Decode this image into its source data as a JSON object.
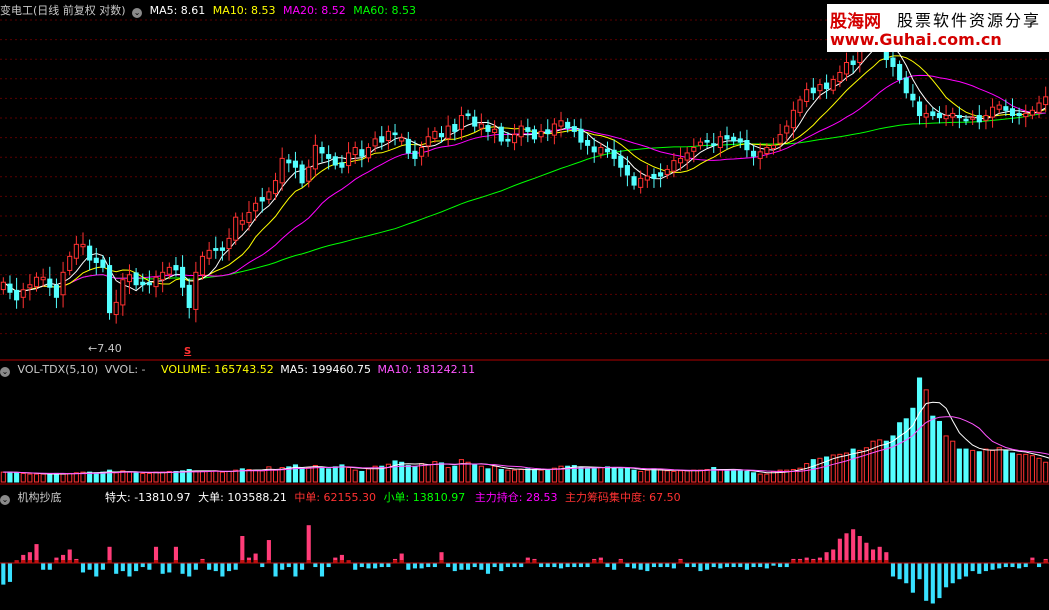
{
  "colors": {
    "up": "#ff3232",
    "down": "#54ffff",
    "ma5": "#ffffff",
    "ma10": "#ffff00",
    "ma20": "#ff00ff",
    "ma60": "#00ff00",
    "grid": "#5a0000",
    "sep": "#b00000",
    "vma5": "#ffffff",
    "vma10": "#ff55ff",
    "pos": "#ff3c78",
    "neg": "#38e0ff"
  },
  "price_header": {
    "title": "变电工(日线 前复权 对数)",
    "ma5_label": "MA5: 8.61",
    "ma10_label": "MA10: 8.53",
    "ma20_label": "MA20: 8.52",
    "ma60_label": "MA60: 8.53"
  },
  "watermark": {
    "line1": "股海网",
    "line2": "股票软件资源分享",
    "line3": "www.Guhai.com.cn"
  },
  "annotations": {
    "low_label": "←7.40",
    "s_marker": "S"
  },
  "volume_header": {
    "name": "VOL-TDX(5,10)",
    "vvol": "VVOL: -",
    "volume": "VOLUME: 165743.52",
    "ma5": "MA5: 199460.75",
    "ma10": "MA10: 181242.11"
  },
  "indicator_header": {
    "name": "机构抄底",
    "tedа": "",
    "teda": "特大: -13810.97",
    "dadan": "大单: 103588.21",
    "zhongdan": "中单: 62155.30",
    "xiaodan": "小单: 13810.97",
    "zhuli_chicang": "主力持仓: 28.53",
    "zhuli_jizhong": "主力筹码集中度: 67.50"
  },
  "chart_data": [
    {
      "type": "candlestick",
      "title": "变电工(日线 前复权 对数)",
      "y_estimated_range": [
        7.2,
        10.2
      ],
      "low_annotation": 7.4,
      "closes": [
        7.74,
        7.66,
        7.6,
        7.68,
        7.72,
        7.78,
        7.78,
        7.7,
        7.62,
        7.82,
        7.95,
        8.05,
        8.05,
        7.92,
        7.9,
        7.86,
        7.5,
        7.58,
        7.76,
        7.8,
        7.72,
        7.72,
        7.72,
        7.78,
        7.82,
        7.86,
        7.84,
        7.7,
        7.54,
        7.82,
        7.95,
        8.0,
        8.0,
        8.0,
        8.1,
        8.28,
        8.25,
        8.32,
        8.4,
        8.42,
        8.5,
        8.6,
        8.8,
        8.76,
        8.72,
        8.58,
        8.72,
        8.92,
        8.85,
        8.8,
        8.74,
        8.72,
        8.85,
        8.9,
        8.82,
        8.9,
        8.98,
        8.95,
        9.05,
        9.02,
        8.99,
        8.85,
        8.8,
        8.9,
        9.0,
        9.05,
        9.0,
        9.1,
        9.05,
        9.2,
        9.2,
        9.1,
        9.12,
        9.05,
        9.07,
        8.96,
        8.96,
        9.02,
        9.1,
        9.05,
        8.98,
        9.05,
        9.03,
        9.12,
        9.15,
        9.08,
        9.05,
        8.95,
        8.92,
        8.86,
        8.9,
        8.86,
        8.8,
        8.72,
        8.65,
        8.56,
        8.62,
        8.64,
        8.62,
        8.64,
        8.7,
        8.78,
        8.8,
        8.85,
        8.9,
        8.95,
        8.95,
        8.92,
        9.0,
        8.98,
        8.96,
        8.95,
        8.88,
        8.82,
        8.86,
        8.9,
        8.92,
        9.02,
        9.1,
        9.25,
        9.35,
        9.45,
        9.42,
        9.5,
        9.46,
        9.55,
        9.62,
        9.72,
        9.7,
        9.85,
        9.95,
        10.0,
        10.05,
        9.75,
        9.68,
        9.55,
        9.42,
        9.35,
        9.2,
        9.22,
        9.2,
        9.18,
        9.2,
        9.22,
        9.18,
        9.15,
        9.18,
        9.14,
        9.2,
        9.28,
        9.3,
        9.25,
        9.2,
        9.2,
        9.22,
        9.25,
        9.32,
        9.38
      ]
    },
    {
      "type": "bar",
      "title": "VOL-TDX(5,10)",
      "volume_latest": 165743.52,
      "ma5_latest": 199460.75,
      "ma10_latest": 181242.11,
      "values": [
        15,
        15,
        14,
        13,
        12,
        12,
        12,
        12,
        13,
        12,
        13,
        14,
        15,
        15,
        14,
        15,
        18,
        14,
        17,
        15,
        14,
        13,
        13,
        15,
        15,
        16,
        16,
        17,
        19,
        16,
        16,
        16,
        17,
        15,
        16,
        18,
        20,
        19,
        18,
        17,
        23,
        18,
        22,
        23,
        26,
        21,
        22,
        25,
        22,
        20,
        23,
        26,
        22,
        18,
        16,
        20,
        24,
        24,
        27,
        32,
        30,
        25,
        23,
        28,
        26,
        31,
        29,
        22,
        24,
        34,
        30,
        26,
        24,
        20,
        24,
        19,
        18,
        18,
        19,
        20,
        19,
        18,
        19,
        21,
        24,
        24,
        25,
        22,
        20,
        22,
        22,
        23,
        22,
        20,
        21,
        18,
        16,
        18,
        20,
        19,
        17,
        16,
        17,
        17,
        18,
        18,
        19,
        22,
        18,
        18,
        19,
        17,
        16,
        14,
        12,
        12,
        16,
        18,
        18,
        19,
        21,
        28,
        34,
        36,
        38,
        41,
        42,
        44,
        50,
        48,
        52,
        62,
        64,
        62,
        70,
        90,
        96,
        112,
        158,
        140,
        100,
        92,
        70,
        62,
        50,
        50,
        48,
        46,
        50,
        48,
        52,
        48,
        44,
        42,
        42,
        40,
        36,
        30,
        26,
        22
      ]
    },
    {
      "type": "bar",
      "title": "机构抄底",
      "values": [
        -16,
        -14,
        2,
        6,
        8,
        14,
        -5,
        -5,
        4,
        6,
        10,
        3,
        -7,
        -5,
        -10,
        -5,
        12,
        -8,
        -6,
        -10,
        -6,
        -3,
        -5,
        12,
        -8,
        -7,
        12,
        -8,
        -10,
        -5,
        3,
        -5,
        -6,
        -10,
        -6,
        -5,
        20,
        4,
        7,
        -3,
        17,
        -10,
        -5,
        -3,
        -10,
        -5,
        28,
        -3,
        -10,
        -3,
        4,
        6,
        2,
        -5,
        -3,
        -4,
        -4,
        -3,
        -3,
        3,
        7,
        -5,
        -4,
        -4,
        -3,
        -3,
        8,
        -3,
        -6,
        -5,
        -5,
        -3,
        -5,
        -8,
        -3,
        -6,
        -3,
        -3,
        -3,
        4,
        3,
        -3,
        -3,
        -3,
        -4,
        -3,
        -3,
        -3,
        -3,
        3,
        4,
        -3,
        -5,
        3,
        -3,
        -4,
        -5,
        -6,
        -3,
        -3,
        -3,
        -4,
        3,
        -3,
        -3,
        -6,
        -5,
        -3,
        -4,
        -3,
        -3,
        -3,
        -5,
        -3,
        -3,
        -4,
        -2,
        -3,
        -3,
        3,
        3,
        4,
        3,
        4,
        8,
        10,
        18,
        22,
        25,
        20,
        15,
        10,
        12,
        8,
        -10,
        -12,
        -15,
        -22,
        -12,
        -28,
        -30,
        -26,
        -18,
        -15,
        -12,
        -10,
        -6,
        -8,
        -6,
        -5,
        -4,
        -3,
        -3,
        -4,
        -3,
        4,
        -3,
        3,
        5,
        8,
        14
      ]
    }
  ]
}
